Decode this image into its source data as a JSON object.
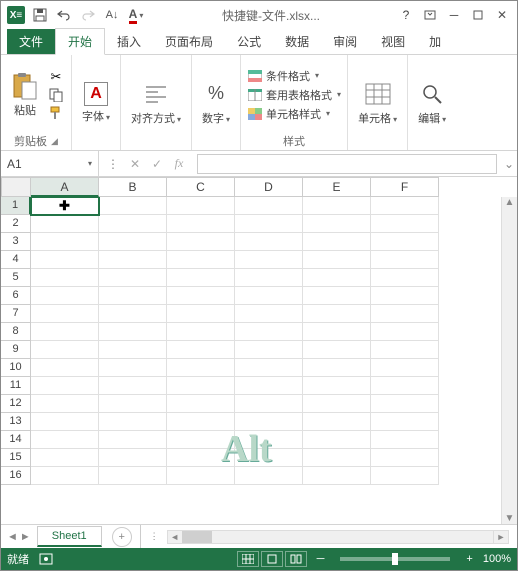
{
  "title": "快捷键-文件.xlsx...",
  "tabs": {
    "file": "文件",
    "home": "开始",
    "insert": "插入",
    "layout": "页面布局",
    "formulas": "公式",
    "data": "数据",
    "review": "审阅",
    "view": "视图",
    "add": "加"
  },
  "ribbon": {
    "clipboard": {
      "paste": "粘贴",
      "label": "剪贴板"
    },
    "font": {
      "btn": "字体"
    },
    "align": {
      "btn": "对齐方式"
    },
    "number": {
      "btn": "数字"
    },
    "styles": {
      "cond": "条件格式",
      "table": "套用表格格式",
      "cell": "单元格样式",
      "label": "样式"
    },
    "cells": {
      "btn": "单元格"
    },
    "editing": {
      "btn": "编辑"
    }
  },
  "namebox": "A1",
  "columns": [
    "A",
    "B",
    "C",
    "D",
    "E",
    "F"
  ],
  "rows": [
    1,
    2,
    3,
    4,
    5,
    6,
    7,
    8,
    9,
    10,
    11,
    12,
    13,
    14,
    15,
    16
  ],
  "watermark": "Alt",
  "sheet": {
    "name": "Sheet1"
  },
  "status": {
    "ready": "就绪",
    "zoom": "100%"
  }
}
